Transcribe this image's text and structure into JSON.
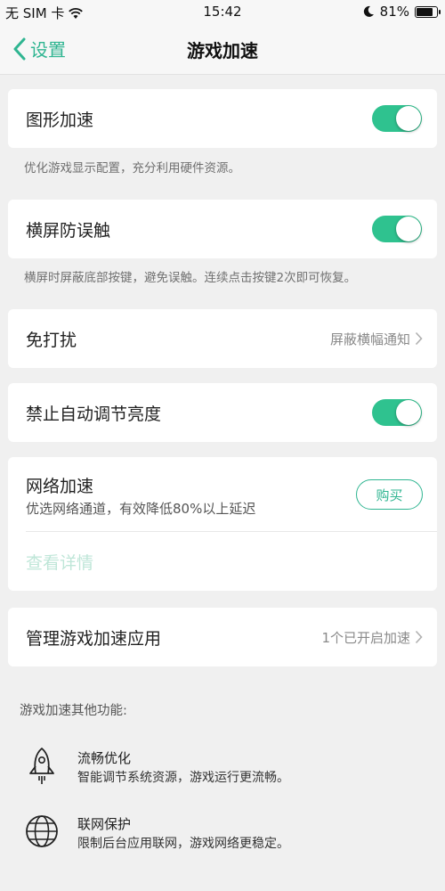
{
  "status_bar": {
    "carrier": "无 SIM 卡",
    "time": "15:42",
    "battery": "81%",
    "battery_level": 0.81
  },
  "header": {
    "back_label": "设置",
    "title": "游戏加速"
  },
  "settings": {
    "graphics": {
      "label": "图形加速",
      "enabled": true,
      "hint": "优化游戏显示配置，充分利用硬件资源。"
    },
    "landscape": {
      "label": "横屏防误触",
      "enabled": true,
      "hint": "横屏时屏蔽底部按键，避免误触。连续点击按键2次即可恢复。"
    },
    "dnd": {
      "label": "免打扰",
      "value": "屏蔽横幅通知"
    },
    "brightness": {
      "label": "禁止自动调节亮度",
      "enabled": true
    },
    "network": {
      "label": "网络加速",
      "sub": "优选网络通道，有效降低80%以上延迟",
      "buy_label": "购买",
      "detail_link": "查看详情"
    },
    "manage": {
      "label": "管理游戏加速应用",
      "value": "1个已开启加速"
    }
  },
  "other": {
    "title": "游戏加速其他功能:",
    "features": [
      {
        "name": "流畅优化",
        "desc": "智能调节系统资源，游戏运行更流畅。",
        "icon": "rocket-icon"
      },
      {
        "name": "联网保护",
        "desc": "限制后台应用联网，游戏网络更稳定。",
        "icon": "globe-icon"
      }
    ]
  },
  "colors": {
    "accent": "#2fb591",
    "toggle_on": "#2fc28f",
    "background": "#f0f0f0"
  }
}
